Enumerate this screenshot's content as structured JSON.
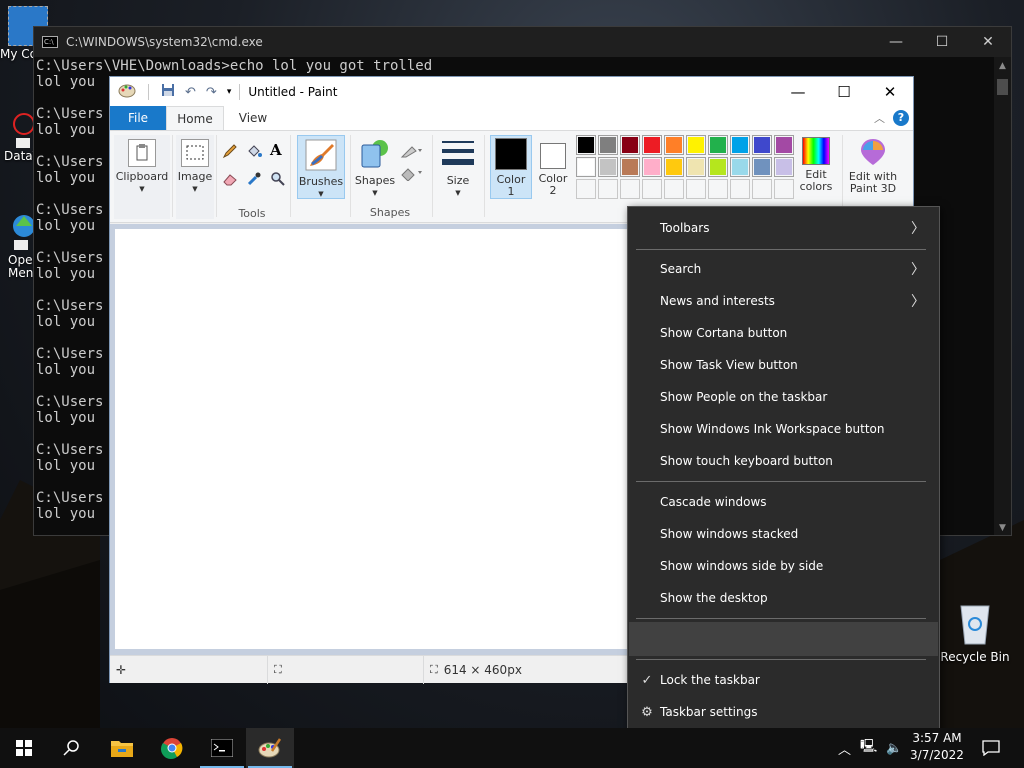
{
  "desktop": {
    "icons": [
      {
        "label": "My Co",
        "name": "desktop-icon-my-computer"
      },
      {
        "label": "DataV",
        "name": "desktop-icon-datav"
      },
      {
        "label": "Open\nMen",
        "name": "desktop-icon-open-menu"
      }
    ],
    "recycle_bin": "Recycle Bin"
  },
  "cmd": {
    "title": "C:\\WINDOWS\\system32\\cmd.exe",
    "lines": [
      "C:\\Users\\VHE\\Downloads>echo lol you got trolled",
      "lol you",
      "",
      "C:\\Users",
      "lol you",
      "",
      "C:\\Users",
      "lol you",
      "",
      "C:\\Users",
      "lol you",
      "",
      "C:\\Users",
      "lol you",
      "",
      "C:\\Users",
      "lol you",
      "",
      "C:\\Users",
      "lol you",
      "",
      "C:\\Users",
      "lol you",
      "",
      "C:\\Users",
      "lol you",
      "",
      "C:\\Users",
      "lol you"
    ]
  },
  "paint": {
    "title": "Untitled - Paint",
    "tabs": {
      "file": "File",
      "home": "Home",
      "view": "View"
    },
    "groups": {
      "clipboard": "Clipboard",
      "image": "Image",
      "tools": "Tools",
      "brushes": "Brushes",
      "shapes": "Shapes",
      "shapes_group": "Shapes",
      "size": "Size",
      "color1": "Color\n1",
      "color2": "Color\n2",
      "edit_colors": "Edit\ncolors",
      "edit_paint3d": "Edit with\nPaint 3D"
    },
    "palette_row1": [
      "#000000",
      "#7f7f7f",
      "#880015",
      "#ed1c24",
      "#ff7f27",
      "#fff200",
      "#22b14c",
      "#00a2e8",
      "#3f48cc",
      "#a349a4"
    ],
    "palette_row2": [
      "#ffffff",
      "#c3c3c3",
      "#b97a57",
      "#ffaec9",
      "#ffc90e",
      "#efe4b0",
      "#b5e61d",
      "#99d9ea",
      "#7092be",
      "#c8bfe7"
    ],
    "status_size": "614 × 460px"
  },
  "context_menu": {
    "toolbars": "Toolbars",
    "search": "Search",
    "news": "News and interests",
    "cortana": "Show Cortana button",
    "taskview": "Show Task View button",
    "people": "Show People on the taskbar",
    "ink": "Show Windows Ink Workspace button",
    "touch_keyboard": "Show touch keyboard button",
    "cascade": "Cascade windows",
    "stacked": "Show windows stacked",
    "side_by_side": "Show windows side by side",
    "desktop": "Show the desktop",
    "lock": "Lock the taskbar",
    "settings": "Taskbar settings"
  },
  "taskbar": {
    "time": "3:57 AM",
    "date": "3/7/2022"
  }
}
